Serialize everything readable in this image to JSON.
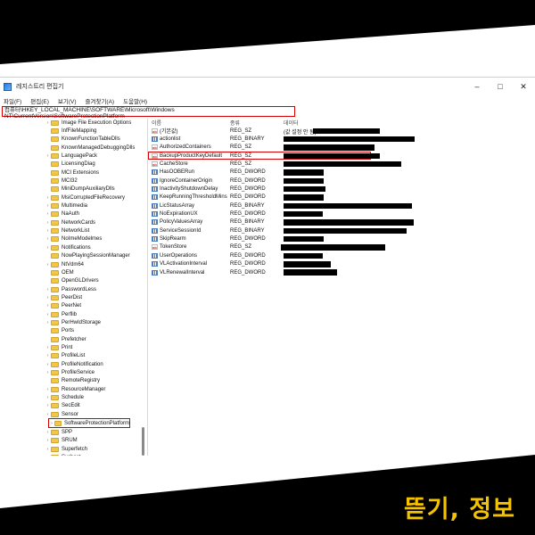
{
  "window": {
    "title": "레지스트리 편집기",
    "controls": [
      "–",
      "□",
      "✕"
    ]
  },
  "menu": [
    "파일(F)",
    "편집(E)",
    "보기(V)",
    "즐겨찾기(A)",
    "도움말(H)"
  ],
  "address": "컴퓨터\\HKEY_LOCAL_MACHINE\\SOFTWARE\\Microsoft\\Windows NT\\CurrentVersion\\SoftwareProtectionPlatform",
  "tree": [
    {
      "label": "Image File Execution Options",
      "expandable": true
    },
    {
      "label": "InfFileMapping",
      "expandable": false
    },
    {
      "label": "KnownFunctionTableDlls",
      "expandable": false
    },
    {
      "label": "KnownManagedDebuggingDlls",
      "expandable": false
    },
    {
      "label": "LanguagePack",
      "expandable": true
    },
    {
      "label": "LicensingDiag",
      "expandable": false
    },
    {
      "label": "MCI Extensions",
      "expandable": false
    },
    {
      "label": "MCI32",
      "expandable": false
    },
    {
      "label": "MiniDumpAuxiliaryDlls",
      "expandable": false
    },
    {
      "label": "MsiCorruptedFileRecovery",
      "expandable": true
    },
    {
      "label": "Multimedia",
      "expandable": true
    },
    {
      "label": "NaAuth",
      "expandable": true
    },
    {
      "label": "NetworkCards",
      "expandable": true
    },
    {
      "label": "NetworkList",
      "expandable": true
    },
    {
      "label": "NoImeModelmes",
      "expandable": true
    },
    {
      "label": "Notifications",
      "expandable": true
    },
    {
      "label": "NowPlayingSessionManager",
      "expandable": false
    },
    {
      "label": "NtVdm64",
      "expandable": true
    },
    {
      "label": "OEM",
      "expandable": false
    },
    {
      "label": "OpenGLDrivers",
      "expandable": false
    },
    {
      "label": "PasswordLess",
      "expandable": true
    },
    {
      "label": "PeerDist",
      "expandable": true
    },
    {
      "label": "PeerNet",
      "expandable": true
    },
    {
      "label": "Perflib",
      "expandable": true
    },
    {
      "label": "PerHwIdStorage",
      "expandable": true
    },
    {
      "label": "Ports",
      "expandable": false
    },
    {
      "label": "Prefetcher",
      "expandable": false
    },
    {
      "label": "Print",
      "expandable": true
    },
    {
      "label": "ProfileList",
      "expandable": true
    },
    {
      "label": "ProfileNotification",
      "expandable": true
    },
    {
      "label": "ProfileService",
      "expandable": true
    },
    {
      "label": "RemoteRegistry",
      "expandable": false
    },
    {
      "label": "ResourceManager",
      "expandable": true
    },
    {
      "label": "Schedule",
      "expandable": true
    },
    {
      "label": "SecEdit",
      "expandable": true
    },
    {
      "label": "Sensor",
      "expandable": true
    },
    {
      "label": "SoftwareProtectionPlatform",
      "expandable": true,
      "selected": true
    },
    {
      "label": "SPP",
      "expandable": true
    },
    {
      "label": "SRUM",
      "expandable": true
    },
    {
      "label": "Superfetch",
      "expandable": true
    },
    {
      "label": "Svchost",
      "expandable": true
    }
  ],
  "columns": {
    "name": "이름",
    "type": "종류",
    "data": "데이터"
  },
  "values": [
    {
      "name": "(기본값)",
      "type": "REG_SZ",
      "data": "(값 설정 안 됨)",
      "icon": "string-value-icon",
      "redacted": true,
      "redact_start": 0.22,
      "redact_len": 0.5
    },
    {
      "name": "actionlist",
      "type": "REG_BINARY",
      "data": "",
      "icon": "binary-value-icon",
      "redacted": true,
      "redact_start": 0.0,
      "redact_len": 0.98
    },
    {
      "name": "AuthorizedContainers",
      "type": "REG_SZ",
      "data": "",
      "icon": "string-value-icon",
      "redacted": true,
      "redact_start": 0.0,
      "redact_len": 0.68
    },
    {
      "name": "BackupProductKeyDefault",
      "type": "REG_SZ",
      "data": "",
      "icon": "string-value-icon",
      "redacted": true,
      "redact_start": 0.0,
      "redact_len": 0.72,
      "highlight": true
    },
    {
      "name": "CacheStore",
      "type": "REG_SZ",
      "data": "",
      "icon": "string-value-icon",
      "redacted": true,
      "redact_start": 0.0,
      "redact_len": 0.88
    },
    {
      "name": "HasOOBERun",
      "type": "REG_DWORD",
      "data": "",
      "icon": "binary-value-icon",
      "redacted": true,
      "redact_start": 0.0,
      "redact_len": 0.3
    },
    {
      "name": "IgnoreContainerOrigin",
      "type": "REG_DWORD",
      "data": "",
      "icon": "binary-value-icon",
      "redacted": true,
      "redact_start": 0.0,
      "redact_len": 0.3
    },
    {
      "name": "InactivityShutdownDelay",
      "type": "REG_DWORD",
      "data": "",
      "icon": "binary-value-icon",
      "redacted": true,
      "redact_start": 0.0,
      "redact_len": 0.31
    },
    {
      "name": "KeepRunningThresholdMins",
      "type": "REG_DWORD",
      "data": "",
      "icon": "binary-value-icon",
      "redacted": true,
      "redact_start": 0.0,
      "redact_len": 0.3
    },
    {
      "name": "LicStatusArray",
      "type": "REG_BINARY",
      "data": "",
      "icon": "binary-value-icon",
      "redacted": true,
      "redact_start": 0.0,
      "redact_len": 0.96
    },
    {
      "name": "NoExpirationUX",
      "type": "REG_DWORD",
      "data": "",
      "icon": "binary-value-icon",
      "redacted": true,
      "redact_start": 0.0,
      "redact_len": 0.29
    },
    {
      "name": "PolicyValuesArray",
      "type": "REG_BINARY",
      "data": "",
      "icon": "binary-value-icon",
      "redacted": true,
      "redact_start": 0.0,
      "redact_len": 0.97
    },
    {
      "name": "ServiceSessionId",
      "type": "REG_BINARY",
      "data": "",
      "icon": "binary-value-icon",
      "redacted": true,
      "redact_start": 0.0,
      "redact_len": 0.92
    },
    {
      "name": "SkipRearm",
      "type": "REG_DWORD",
      "data": "",
      "icon": "binary-value-icon",
      "redacted": true,
      "redact_start": 0.0,
      "redact_len": 0.3
    },
    {
      "name": "TokenStore",
      "type": "REG_SZ",
      "data": "",
      "icon": "string-value-icon",
      "redacted": true,
      "redact_start": -0.02,
      "redact_len": 0.78
    },
    {
      "name": "UserOperations",
      "type": "REG_DWORD",
      "data": "",
      "icon": "binary-value-icon",
      "redacted": true,
      "redact_start": 0.0,
      "redact_len": 0.29
    },
    {
      "name": "VLActivationInterval",
      "type": "REG_DWORD",
      "data": "",
      "icon": "binary-value-icon",
      "redacted": true,
      "redact_start": 0.0,
      "redact_len": 0.35
    },
    {
      "name": "VLRenewalInterval",
      "type": "REG_DWORD",
      "data": "",
      "icon": "binary-value-icon",
      "redacted": true,
      "redact_start": 0.0,
      "redact_len": 0.4
    }
  ],
  "caption": "뜯기, 정보",
  "colors": {
    "banner": "#000000",
    "caption": "#f5c200",
    "highlight": "#d40000"
  }
}
